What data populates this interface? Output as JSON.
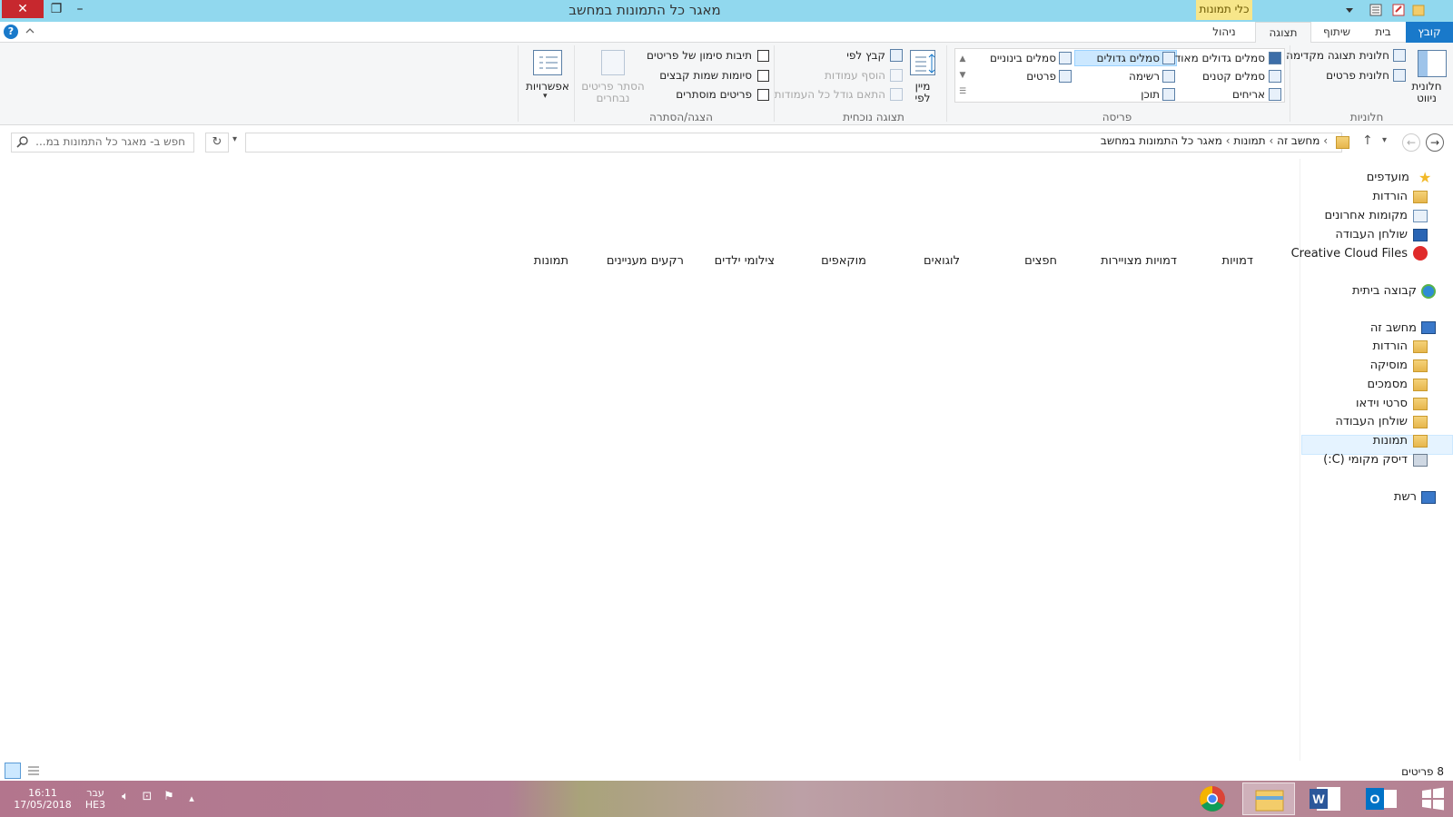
{
  "window": {
    "title": "מאגר כל התמונות במחשב",
    "contextual_tab_group": "כלי תמונות"
  },
  "tabs": {
    "file": "קובץ",
    "home": "בית",
    "share": "שיתוף",
    "view": "תצוגה",
    "manage": "ניהול"
  },
  "ribbon": {
    "panes": {
      "label": "חלוניות",
      "navigation_pane_1": "חלונית",
      "navigation_pane_2": "ניווט",
      "preview_pane": "חלונית תצוגה מקדימה",
      "details_pane": "חלונית פרטים"
    },
    "layout": {
      "label": "פריסה",
      "extra_large_icons": "סמלים גדולים מאוד",
      "large_icons": "סמלים גדולים",
      "medium_icons": "סמלים בינוניים",
      "small_icons": "סמלים קטנים",
      "list": "רשימה",
      "details": "פרטים",
      "tiles": "אריחים",
      "content": "תוכן"
    },
    "current_view": {
      "label": "תצוגה נוכחית",
      "sort_by_1": "מיין",
      "sort_by_2": "לפי",
      "group_by": "קבץ לפי",
      "add_columns": "הוסף עמודות",
      "size_all_columns": "התאם גודל כל העמודות"
    },
    "show_hide": {
      "label": "הצגה/הסתרה",
      "item_checkboxes": "תיבות סימון של פריטים",
      "file_extensions": "סיומות שמות קבצים",
      "hidden_items": "פריטים מוסתרים",
      "hide_selected_1": "הסתר פריטים",
      "hide_selected_2": "נבחרים"
    },
    "options": "אפשרויות"
  },
  "address": {
    "crumbs": [
      "מחשב זה",
      "תמונות",
      "מאגר כל התמונות במחשב"
    ],
    "search_placeholder": "חפש ב- מאגר כל התמונות במ..."
  },
  "content": {
    "columns": [
      "דמויות",
      "דמויות מצויירות",
      "חפצים",
      "לוגואים",
      "מוקאפים",
      "צילומי ילדים",
      "רקעים מעניינים",
      "תמונות"
    ]
  },
  "nav": {
    "favorites": "מועדפים",
    "fav_downloads": "הורדות",
    "recent_places": "מקומות אחרונים",
    "fav_desktop": "שולחן העבודה",
    "creative_cloud": "Creative Cloud Files",
    "homegroup": "קבוצה ביתית",
    "this_pc": "מחשב זה",
    "downloads": "הורדות",
    "music": "מוסיקה",
    "documents": "מסמכים",
    "videos": "סרטי וידאו",
    "desktop": "שולחן העבודה",
    "pictures": "תמונות",
    "local_disk": "דיסק מקומי (C:)",
    "network": "רשת"
  },
  "status": {
    "item_count": "8 פריטים"
  },
  "taskbar": {
    "time": "16:11",
    "date": "17/05/2018",
    "lang_1": "עבר",
    "lang_2": "HE3"
  },
  "colors": {
    "titlebar": "#91d8ee",
    "file_tab": "#1979ca",
    "close_button": "#c7282e",
    "contextual_tab": "#f7e68a"
  }
}
